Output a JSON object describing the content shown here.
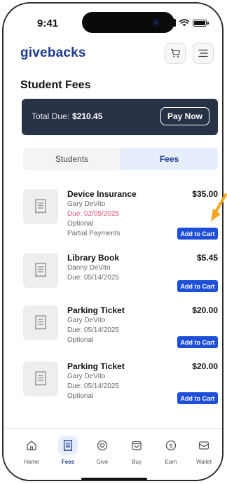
{
  "status_bar": {
    "time": "9:41"
  },
  "app": {
    "logo": "givebacks"
  },
  "page": {
    "title": "Student Fees"
  },
  "summary": {
    "total_label": "Total Due:",
    "total_amount": "$210.45",
    "pay_label": "Pay Now"
  },
  "tabs": [
    {
      "label": "Students",
      "active": false
    },
    {
      "label": "Fees",
      "active": true
    }
  ],
  "fees": [
    {
      "name": "Device Insurance",
      "amount": "$35.00",
      "student": "Gary DeVito",
      "due": "Due: 02/05/2025",
      "due_overdue": true,
      "lines": [
        "Optional",
        "Partial Payments"
      ],
      "button": "Add to Cart"
    },
    {
      "name": "Library Book",
      "amount": "$5.45",
      "student": "Danny DeVito",
      "due": "Due: 05/14/2025",
      "due_overdue": false,
      "lines": [],
      "button": "Add to Cart"
    },
    {
      "name": "Parking Ticket",
      "amount": "$20.00",
      "student": "Gary DeVito",
      "due": "Due: 05/14/2025",
      "due_overdue": false,
      "lines": [
        "Optional"
      ],
      "button": "Add to Cart"
    },
    {
      "name": "Parking Ticket",
      "amount": "$20.00",
      "student": "Gary DeVito",
      "due": "Due: 05/14/2025",
      "due_overdue": false,
      "lines": [
        "Optional"
      ],
      "button": "Add to Cart"
    }
  ],
  "nav": [
    {
      "label": "Home",
      "icon": "home-icon",
      "active": false
    },
    {
      "label": "Fees",
      "icon": "receipt-icon",
      "active": true
    },
    {
      "label": "Give",
      "icon": "heart-icon",
      "active": false
    },
    {
      "label": "Buy",
      "icon": "shopping-bag-icon",
      "active": false
    },
    {
      "label": "Earn",
      "icon": "dollar-icon",
      "active": false
    },
    {
      "label": "Wallet",
      "icon": "wallet-icon",
      "active": false
    }
  ],
  "colors": {
    "brand": "#1e3a8a",
    "accent": "#1d4fd8",
    "dark_panel": "#283247",
    "overdue": "#e6547c",
    "callout_arrow": "#f5a623"
  }
}
